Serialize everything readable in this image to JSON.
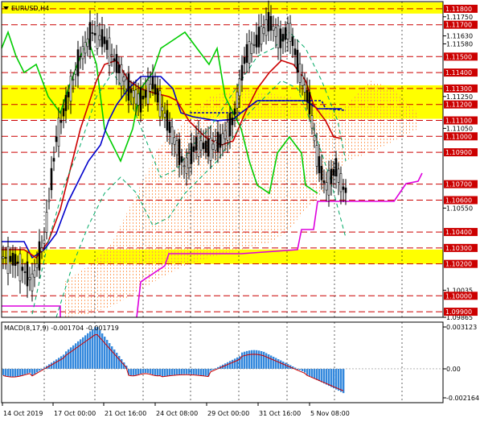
{
  "title": "EURUSD,H4",
  "macd_label": "MACD(8,17,9) -0.001704 -0.001719",
  "colors": {
    "zone": "#ffff00",
    "level_line": "#cc0000",
    "grid": "#000000",
    "candle": "#000000",
    "bull_candle": "#00aa00",
    "ichi_tenkan": "#cc0000",
    "ichi_kijun": "#0000cc",
    "ichi_chikou": "#00cc00",
    "cloud": "#ff9955",
    "envelope_low": "#dd00dd",
    "envelope_band": "#00aa66",
    "macd_hist": "#3388dd",
    "macd_signal": "#cc0000"
  },
  "price_axis": {
    "min": 1.09865,
    "max": 1.11845,
    "plain_labels": [
      "1.11750",
      "1.11630",
      "1.11580",
      "1.11250",
      "1.11050",
      "1.10550",
      "1.10035",
      "1.09865"
    ],
    "boxed_labels": [
      "1.11800",
      "1.11700",
      "1.11500",
      "1.11400",
      "1.11300",
      "1.11200",
      "1.11100",
      "1.11000",
      "1.10900",
      "1.10700",
      "1.10600",
      "1.10400",
      "1.10300",
      "1.10200",
      "1.10000",
      "1.09900"
    ],
    "plain_values": [
      1.1175,
      1.1163,
      1.1158,
      1.1125,
      1.1105,
      1.1055,
      1.10035,
      1.09865
    ],
    "boxed_values": [
      1.118,
      1.117,
      1.115,
      1.114,
      1.113,
      1.112,
      1.111,
      1.11,
      1.109,
      1.107,
      1.106,
      1.104,
      1.103,
      1.102,
      1.1,
      1.099
    ]
  },
  "zones": [
    [
      1.1177,
      1.1184
    ],
    [
      1.1111,
      1.1132
    ],
    [
      1.102,
      1.1029
    ]
  ],
  "macd_axis": {
    "labels": [
      "0.003123",
      "0.00",
      "-0.002164"
    ],
    "values": [
      0.003123,
      0,
      -0.002164
    ]
  },
  "time_axis": {
    "labels": [
      "14 Oct 2019",
      "17 Oct 00:00",
      "21 Oct 16:00",
      "24 Oct 08:00",
      "29 Oct 00:00",
      "31 Oct 16:00",
      "5 Nov 08:00"
    ]
  }
}
